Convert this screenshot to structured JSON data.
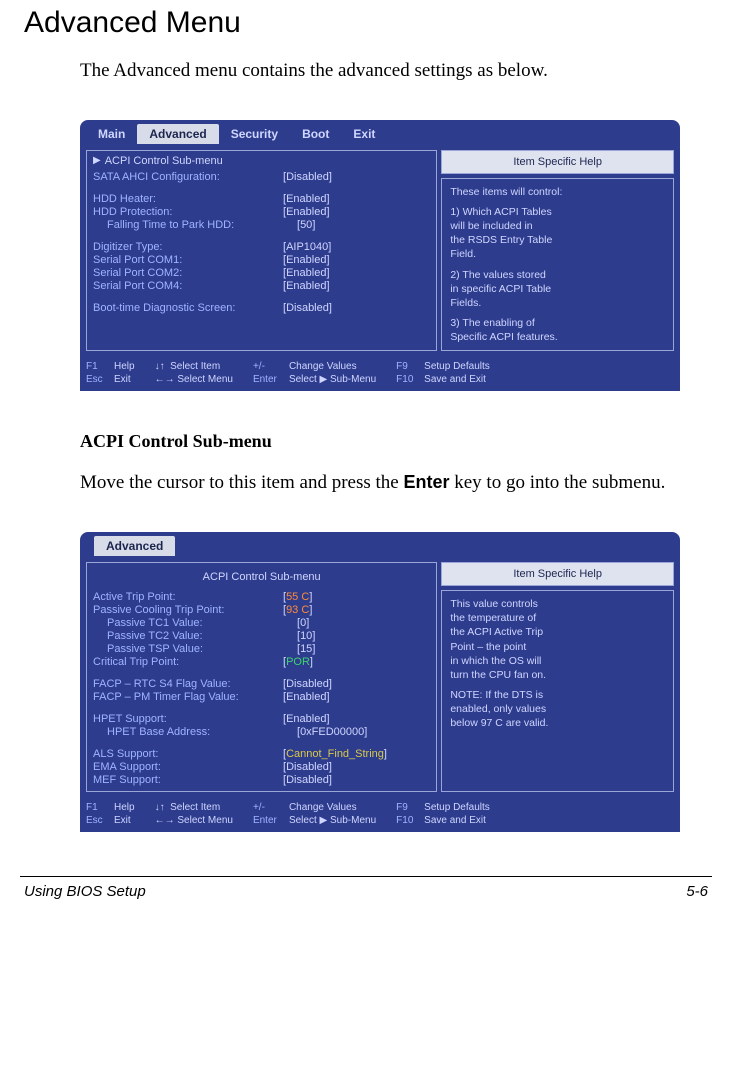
{
  "heading": "Advanced Menu",
  "intro": "The Advanced menu contains the advanced settings as below.",
  "tabs": [
    "Main",
    "Advanced",
    "Security",
    "Boot",
    "Exit"
  ],
  "bios1": {
    "arrow_item": "ACPI Control Sub-menu",
    "rows": [
      {
        "label": "SATA AHCI Configuration:",
        "value": "Disabled"
      },
      {
        "gap": true
      },
      {
        "label": "HDD Heater:",
        "value": "Enabled"
      },
      {
        "label": "HDD Protection:",
        "value": "Enabled"
      },
      {
        "label": "Falling Time to Park HDD:",
        "value": "50",
        "indent": true
      },
      {
        "gap": true
      },
      {
        "label": "Digitizer Type:",
        "value": "AIP1040"
      },
      {
        "label": "Serial Port COM1:",
        "value": "Enabled"
      },
      {
        "label": "Serial Port COM2:",
        "value": "Enabled"
      },
      {
        "label": "Serial Port COM4:",
        "value": "Enabled"
      },
      {
        "gap": true
      },
      {
        "label": "Boot-time Diagnostic Screen:",
        "value": "Disabled"
      }
    ],
    "help_title": "Item Specific Help",
    "help_lines": [
      "These items will control:",
      "",
      "1) Which ACPI Tables",
      "    will be included in",
      "    the RSDS Entry Table",
      "    Field.",
      "",
      "2) The values stored",
      "    in specific ACPI Table",
      "    Fields.",
      "",
      "3) The enabling of",
      "    Specific ACPI features."
    ]
  },
  "section_heading": "ACPI Control Sub-menu",
  "section_text_before": "Move the cursor to this item and press the ",
  "section_key": "Enter",
  "section_text_after": " key to go into the submenu.",
  "bios2": {
    "tab": "Advanced",
    "submenu_title": "ACPI Control Sub-menu",
    "rows": [
      {
        "label": "Active Trip Point:",
        "value": "55 C",
        "hot": true
      },
      {
        "label": "Passive Cooling Trip Point:",
        "value": "93 C",
        "hot": true
      },
      {
        "label": "Passive TC1 Value:",
        "value": "0",
        "indent": true
      },
      {
        "label": "Passive TC2 Value:",
        "value": "10",
        "indent": true
      },
      {
        "label": "Passive TSP Value:",
        "value": "15",
        "indent": true
      },
      {
        "label": "Critical Trip Point:",
        "value": "POR",
        "green": true
      },
      {
        "gap": true
      },
      {
        "label": "FACP – RTC S4 Flag Value:",
        "value": "Disabled"
      },
      {
        "label": "FACP – PM Timer Flag Value:",
        "value": "Enabled"
      },
      {
        "gap": true
      },
      {
        "label": "HPET Support:",
        "value": "Enabled"
      },
      {
        "label": "HPET Base Address:",
        "value": "0xFED00000",
        "indent": true
      },
      {
        "gap": true
      },
      {
        "label": "ALS Support:",
        "value": "Cannot_Find_String",
        "yellow": true
      },
      {
        "label": "EMA Support:",
        "value": "Disabled"
      },
      {
        "label": "MEF Support:",
        "value": "Disabled"
      }
    ],
    "help_title": "Item Specific Help",
    "help_lines": [
      "This value controls",
      "the temperature of",
      "the ACPI Active Trip",
      "Point – the point",
      "in which the OS will",
      "turn the CPU fan on.",
      "",
      "NOTE: If the DTS is",
      "enabled, only values",
      "below 97 C are valid."
    ]
  },
  "footkeys": {
    "f1": "F1",
    "help": "Help",
    "esc": "Esc",
    "exit": "Exit",
    "selitem": "Select Item",
    "selmenu": "Select Menu",
    "pm": "+/-",
    "chg": "Change Values",
    "enter": "Enter",
    "sel_sub": "Select ",
    "sub": " Sub-Menu",
    "f9": "F9",
    "setdef": "Setup Defaults",
    "f10": "F10",
    "save": "Save and Exit"
  },
  "footer_left": "Using BIOS Setup",
  "footer_right": "5-6"
}
